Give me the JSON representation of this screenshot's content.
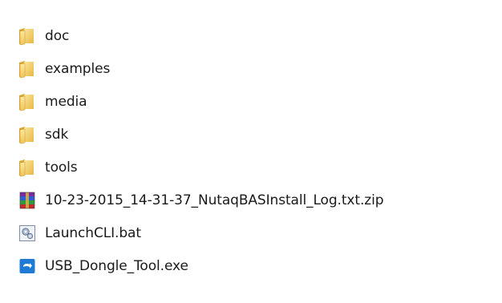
{
  "files": [
    {
      "name": "doc",
      "type": "folder"
    },
    {
      "name": "examples",
      "type": "folder"
    },
    {
      "name": "media",
      "type": "folder"
    },
    {
      "name": "sdk",
      "type": "folder"
    },
    {
      "name": "tools",
      "type": "folder"
    },
    {
      "name": "10-23-2015_14-31-37_NutaqBASInstall_Log.txt.zip",
      "type": "archive"
    },
    {
      "name": "LaunchCLI.bat",
      "type": "batch"
    },
    {
      "name": "USB_Dongle_Tool.exe",
      "type": "executable"
    }
  ],
  "colors": {
    "folder_yellow": "#f3cf5e",
    "folder_dark": "#d9a82e",
    "exe_blue": "#1f7ad6"
  }
}
